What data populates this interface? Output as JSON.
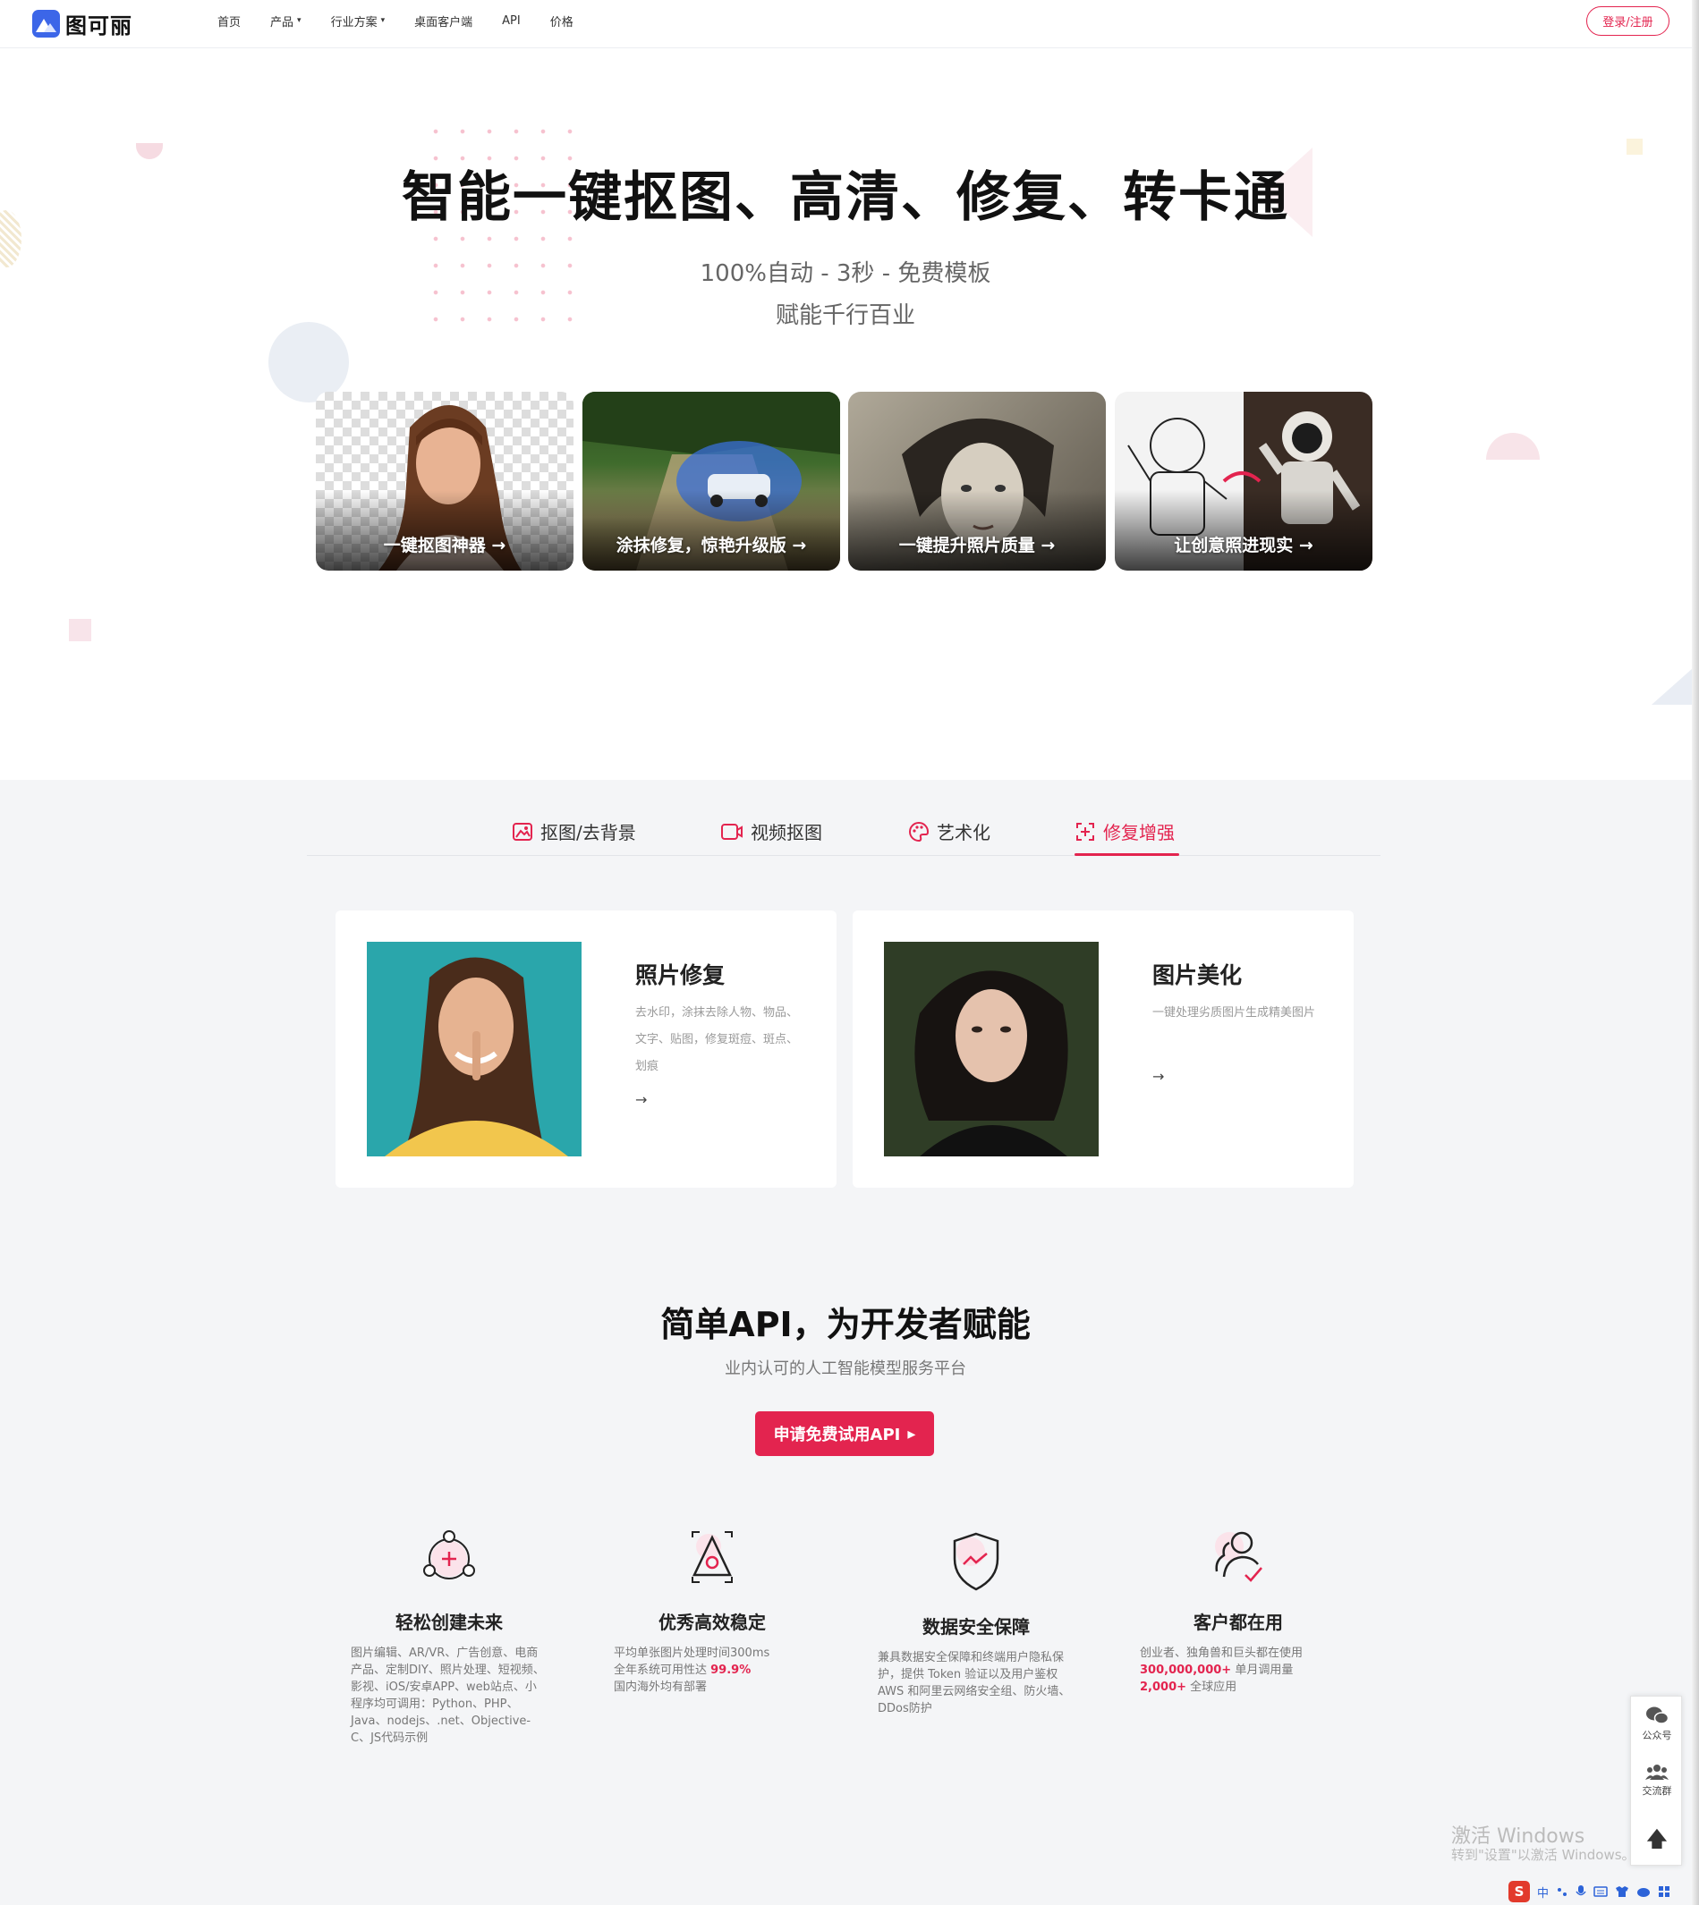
{
  "nav": {
    "logo_text": "图可丽",
    "items": [
      {
        "label": "首页",
        "has_caret": false
      },
      {
        "label": "产品",
        "has_caret": true
      },
      {
        "label": "行业方案",
        "has_caret": true
      },
      {
        "label": "桌面客户端",
        "has_caret": false
      },
      {
        "label": "API",
        "has_caret": false
      },
      {
        "label": "价格",
        "has_caret": false
      }
    ],
    "login_label": "登录/注册",
    "caret_glyph": "▾"
  },
  "hero": {
    "title": "智能一键抠图、高清、修复、转卡通",
    "subtitle": "100%自动 - 3秒 - 免费模板",
    "subtitle2": "赋能千行百业",
    "cards": [
      {
        "label": "一键抠图神器 →",
        "icon": "portrait-cutout"
      },
      {
        "label": "涂抹修复，惊艳升级版 →",
        "icon": "car-inpaint"
      },
      {
        "label": "一键提升照片质量 →",
        "icon": "old-photo-enhance"
      },
      {
        "label": "让创意照进现实 →",
        "icon": "astronaut-sketch"
      }
    ]
  },
  "tabs": [
    {
      "label": "抠图/去背景",
      "icon": "image-icon",
      "active": false
    },
    {
      "label": "视频抠图",
      "icon": "video-icon",
      "active": false
    },
    {
      "label": "艺术化",
      "icon": "palette-icon",
      "active": false
    },
    {
      "label": "修复增强",
      "icon": "enhance-icon",
      "active": true
    }
  ],
  "features_cards": [
    {
      "title": "照片修复",
      "desc": "去水印，涂抹去除人物、物品、文字、贴图，修复斑痘、斑点、划痕",
      "arrow": "→"
    },
    {
      "title": "图片美化",
      "desc": "一键处理劣质图片生成精美图片",
      "arrow": "→"
    }
  ],
  "api": {
    "title": "简单API，为开发者赋能",
    "subtitle": "业内认可的人工智能模型服务平台",
    "button_label": "申请免费试用API",
    "button_icon": "▸"
  },
  "benefits": [
    {
      "title": "轻松创建未来",
      "icon": "create-icon",
      "desc": "图片编辑、AR/VR、广告创意、电商产品、定制DIY、照片处理、短视频、影视、iOS/安卓APP、web站点、小程序均可调用：Python、PHP、Java、nodejs、.net、Objective-C、JS代码示例"
    },
    {
      "title": "优秀高效稳定",
      "icon": "efficient-icon",
      "line1": "平均单张图片处理时间300ms",
      "line2_prefix": "全年系统可用性达 ",
      "line2_hl": "99.9%",
      "line3": "国内海外均有部署"
    },
    {
      "title": "数据安全保障",
      "icon": "shield-icon",
      "desc": "兼具数据安全保障和终端用户隐私保护，提供 Token 验证以及用户鉴权AWS 和阿里云网络安全组、防火墙、DDos防护"
    },
    {
      "title": "客户都在用",
      "icon": "customers-icon",
      "line1": "创业者、独角兽和巨头都在使用",
      "line2_hl": "300,000,000+",
      "line2_suffix": " 单月调用量",
      "line3_hl": "2,000+",
      "line3_suffix": " 全球应用"
    }
  ],
  "side_float": {
    "wechat_label": "公众号",
    "group_label": "交流群",
    "top_icon": "🡅"
  },
  "watermark": {
    "line1": "激活 Windows",
    "line2": "转到\"设置\"以激活 Windows。"
  },
  "tray": {
    "ime_letter": "S",
    "ime_mode": "中"
  },
  "colors": {
    "accent": "#e3244f",
    "brand": "#3c66e8"
  }
}
